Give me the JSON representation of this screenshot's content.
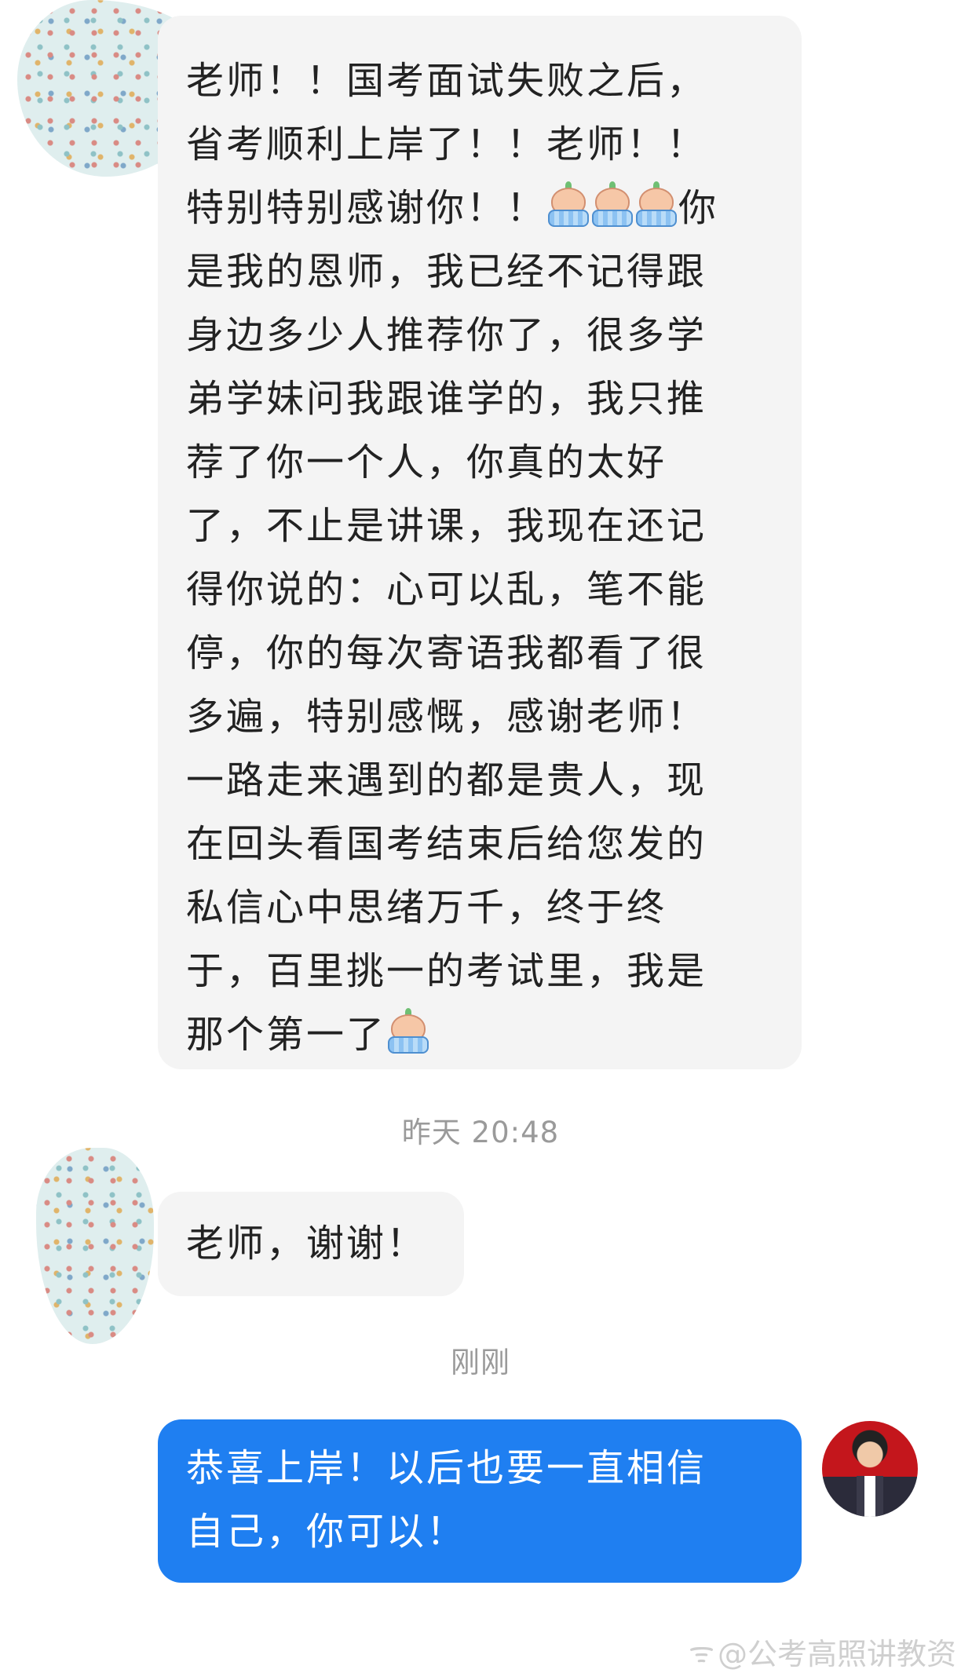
{
  "messages": [
    {
      "from": "student",
      "lines": [
        "老师！！国考面试失败之后，",
        "省考顺利上岸了！！老师！！",
        "特别特别感谢你！！",
        "是我的恩师，我已经不记得跟",
        "身边多少人推荐你了，很多学",
        "弟学妹问我跟谁学的，我只推",
        "荐了你一个人，你真的太好",
        "了，不止是讲课，我现在还记",
        "得你说的：心可以乱，笔不能",
        "停，你的每次寄语我都看了很",
        "多遍，特别感慨，感谢老师！",
        "一路走来遇到的都是贵人，现",
        "在回头看国考结束后给您发的",
        "私信心中思绪万千，终于终",
        "于，百里挑一的考试里，我是",
        "那个第一了"
      ],
      "line3_tail": "你",
      "emoji_name": "crying-emoji"
    },
    {
      "from": "student",
      "timestamp": "昨天 20:48",
      "text": "老师，谢谢！"
    },
    {
      "from": "teacher",
      "timestamp": "刚刚",
      "lines": [
        "恭喜上岸！以后也要一直相信",
        "自己，你可以！"
      ]
    }
  ],
  "watermark": {
    "text": "@公考高照讲教资",
    "icon": "weibo-icon"
  },
  "colors": {
    "incoming_bubble": "#f4f4f4",
    "outgoing_bubble": "#1f7ff1",
    "timestamp": "#9a9a9a"
  }
}
